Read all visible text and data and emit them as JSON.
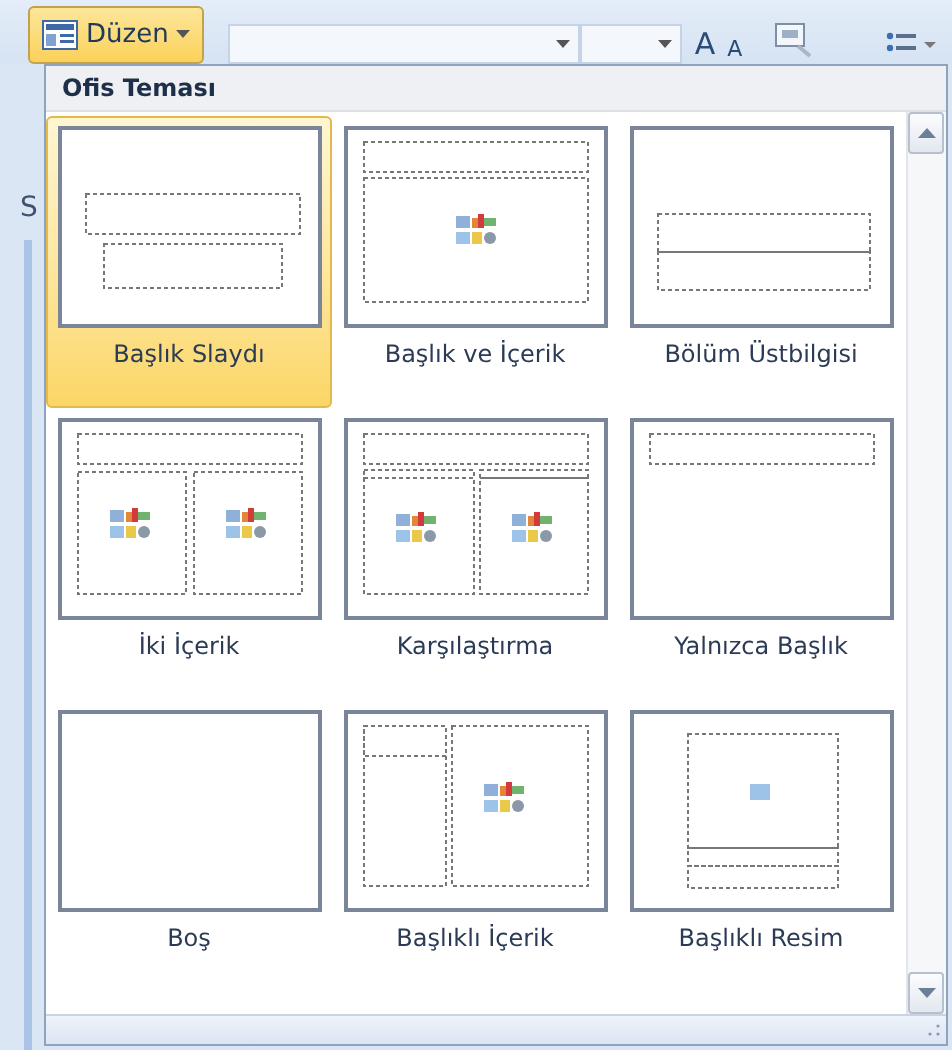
{
  "toolbar": {
    "layout_button": {
      "label": "Düzen",
      "expanded": true
    },
    "grow_font": "A",
    "shrink_font": "A",
    "side_label": "S"
  },
  "gallery": {
    "title": "Ofis Teması",
    "layouts": [
      {
        "name": "Başlık Slaydı",
        "kind": "title",
        "selected": true
      },
      {
        "name": "Başlık ve İçerik",
        "kind": "title-content",
        "selected": false
      },
      {
        "name": "Bölüm Üstbilgisi",
        "kind": "section",
        "selected": false
      },
      {
        "name": "İki İçerik",
        "kind": "two-content",
        "selected": false
      },
      {
        "name": "Karşılaştırma",
        "kind": "comparison",
        "selected": false
      },
      {
        "name": "Yalnızca Başlık",
        "kind": "title-only",
        "selected": false
      },
      {
        "name": "Boş",
        "kind": "blank",
        "selected": false
      },
      {
        "name": "Başlıklı İçerik",
        "kind": "content-caption",
        "selected": false
      },
      {
        "name": "Başlıklı Resim",
        "kind": "picture-caption",
        "selected": false
      }
    ]
  }
}
